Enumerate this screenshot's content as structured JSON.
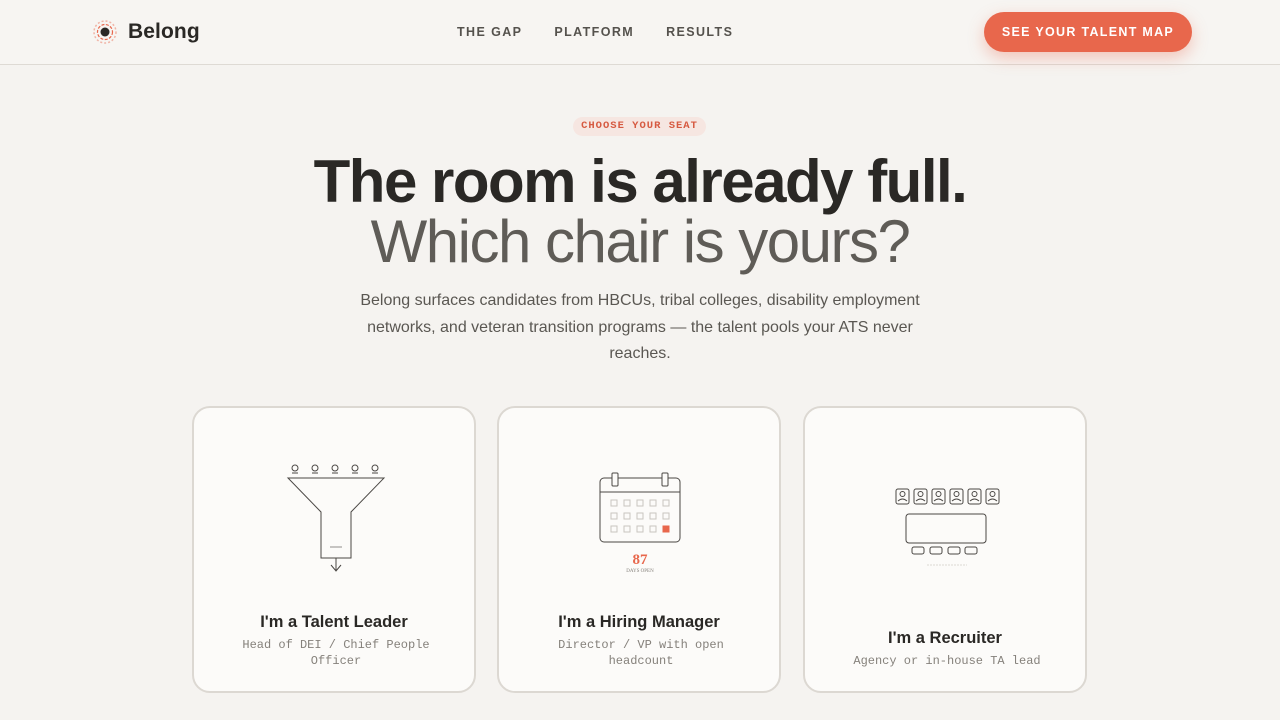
{
  "brand": {
    "name": "Belong",
    "logo_icon": "belong-logo-icon"
  },
  "nav": {
    "links": [
      "THE GAP",
      "PLATFORM",
      "RESULTS"
    ]
  },
  "cta": {
    "label": "SEE YOUR TALENT MAP"
  },
  "hero": {
    "eyebrow": "CHOOSE YOUR SEAT",
    "headline": "The room is already full.",
    "subheadline": "Which chair is yours?",
    "lede": "Belong surfaces candidates from HBCUs, tribal colleges, disability employment networks, and veteran transition programs — the talent pools your ATS never reaches."
  },
  "cards": [
    {
      "title": "I'm a Talent Leader",
      "subtitle": "Head of DEI / Chief People Officer",
      "icon": "funnel-icon"
    },
    {
      "title": "I'm a Hiring Manager",
      "subtitle": "Director / VP with open headcount",
      "icon": "calendar-icon",
      "stat_value": "87",
      "stat_label": "DAYS OPEN"
    },
    {
      "title": "I'm a Recruiter",
      "subtitle": "Agency or in-house TA lead",
      "icon": "desk-seats-icon"
    }
  ],
  "colors": {
    "accent": "#e8674c",
    "background": "#f5f3f0",
    "text": "#2a2825"
  }
}
